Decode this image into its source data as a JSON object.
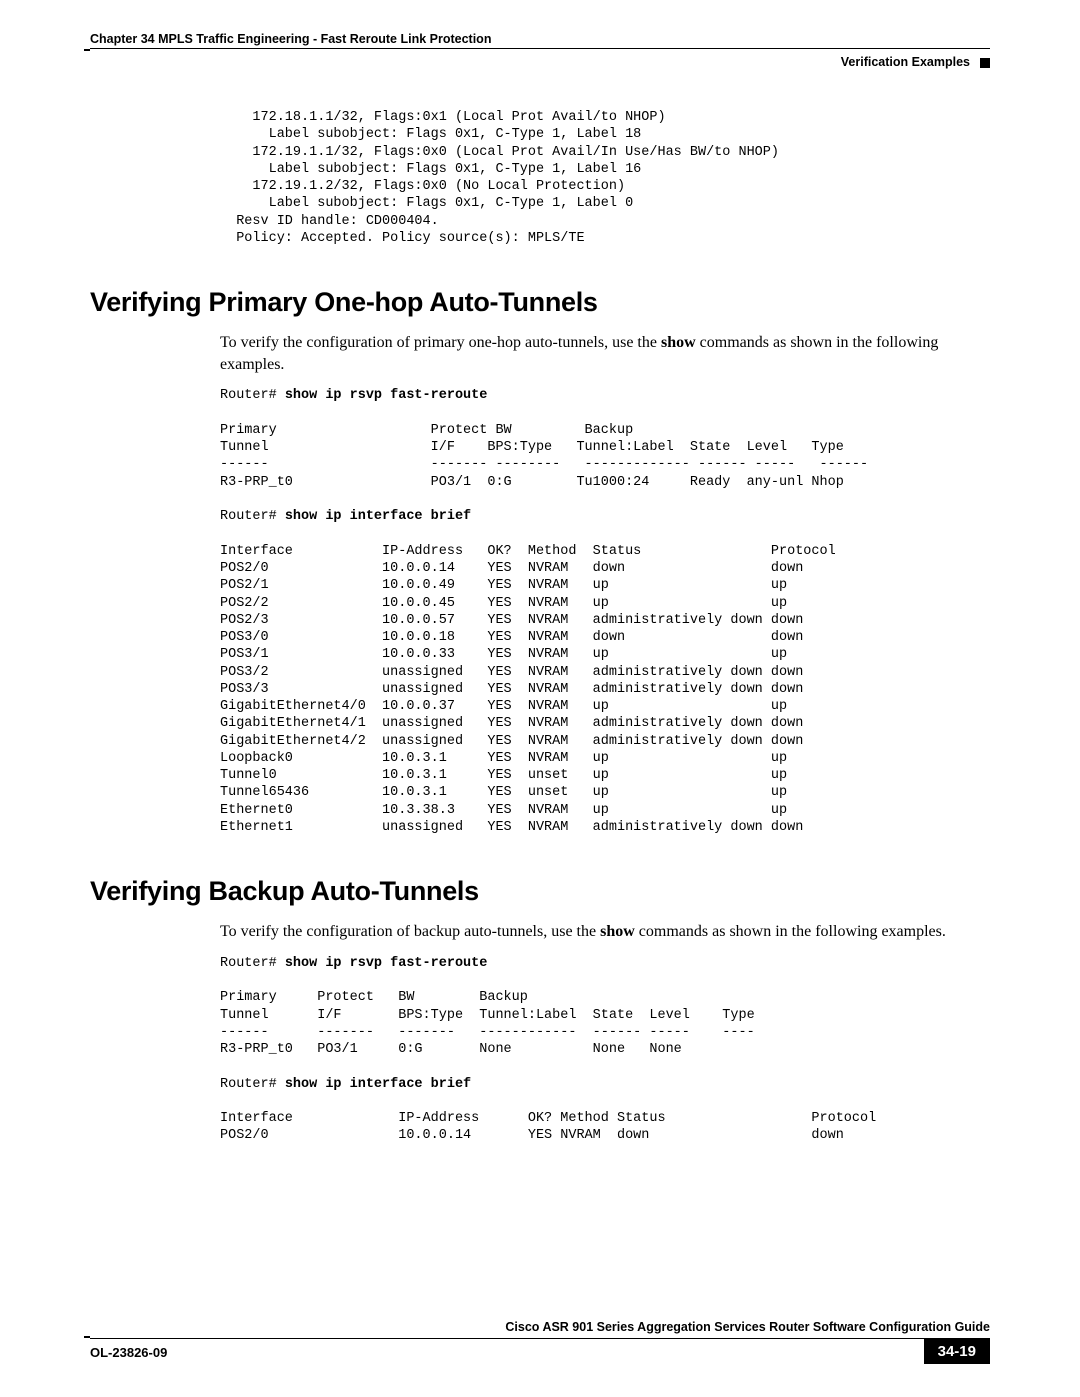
{
  "header": {
    "chapter": "Chapter 34    MPLS Traffic Engineering - Fast Reroute Link Protection",
    "section": "Verification Examples"
  },
  "block1": "    172.18.1.1/32, Flags:0x1 (Local Prot Avail/to NHOP)\n      Label subobject: Flags 0x1, C-Type 1, Label 18\n    172.19.1.1/32, Flags:0x0 (Local Prot Avail/In Use/Has BW/to NHOP)\n      Label subobject: Flags 0x1, C-Type 1, Label 16\n    172.19.1.2/32, Flags:0x0 (No Local Protection)\n      Label subobject: Flags 0x1, C-Type 1, Label 0\n  Resv ID handle: CD000404.\n  Policy: Accepted. Policy source(s): MPLS/TE",
  "section2": {
    "heading": "Verifying Primary One-hop Auto-Tunnels",
    "intro_pre": "To verify the configuration of primary one-hop auto-tunnels, use the ",
    "intro_bold": "show",
    "intro_post": " commands as shown in the following examples.",
    "cmd1_prefix": "Router# ",
    "cmd1": "show ip rsvp fast-reroute",
    "out1": "\nPrimary                   Protect BW         Backup\nTunnel                    I/F    BPS:Type   Tunnel:Label  State  Level   Type\n------                    ------- --------   ------------- ------ -----   ------\nR3-PRP_t0                 PO3/1  0:G        Tu1000:24     Ready  any-unl Nhop\n",
    "cmd2_prefix": "Router# ",
    "cmd2": "show ip interface brief",
    "out2": "\nInterface           IP-Address   OK?  Method  Status                Protocol\nPOS2/0              10.0.0.14    YES  NVRAM   down                  down\nPOS2/1              10.0.0.49    YES  NVRAM   up                    up\nPOS2/2              10.0.0.45    YES  NVRAM   up                    up\nPOS2/3              10.0.0.57    YES  NVRAM   administratively down down\nPOS3/0              10.0.0.18    YES  NVRAM   down                  down\nPOS3/1              10.0.0.33    YES  NVRAM   up                    up\nPOS3/2              unassigned   YES  NVRAM   administratively down down\nPOS3/3              unassigned   YES  NVRAM   administratively down down\nGigabitEthernet4/0  10.0.0.37    YES  NVRAM   up                    up\nGigabitEthernet4/1  unassigned   YES  NVRAM   administratively down down\nGigabitEthernet4/2  unassigned   YES  NVRAM   administratively down down\nLoopback0           10.0.3.1     YES  NVRAM   up                    up\nTunnel0             10.0.3.1     YES  unset   up                    up\nTunnel65436         10.0.3.1     YES  unset   up                    up\nEthernet0           10.3.38.3    YES  NVRAM   up                    up\nEthernet1           unassigned   YES  NVRAM   administratively down down"
  },
  "section3": {
    "heading": "Verifying Backup Auto-Tunnels",
    "intro_pre": "To verify the configuration of backup auto-tunnels, use the ",
    "intro_bold": "show",
    "intro_post": " commands as shown in the following examples.",
    "cmd1_prefix": "Router# ",
    "cmd1": "show ip rsvp fast-reroute",
    "out1": "\nPrimary     Protect   BW        Backup\nTunnel      I/F       BPS:Type  Tunnel:Label  State  Level    Type\n------      -------   -------   ------------  ------ -----    ----\nR3-PRP_t0   PO3/1     0:G       None          None   None\n",
    "cmd2_prefix": "Router# ",
    "cmd2": "show ip interface brief",
    "out2": "\nInterface             IP-Address      OK? Method Status                  Protocol\nPOS2/0                10.0.0.14       YES NVRAM  down                    down"
  },
  "footer": {
    "title": "Cisco ASR 901 Series Aggregation Services Router Software Configuration Guide",
    "doc": "OL-23826-09",
    "page": "34-19"
  }
}
